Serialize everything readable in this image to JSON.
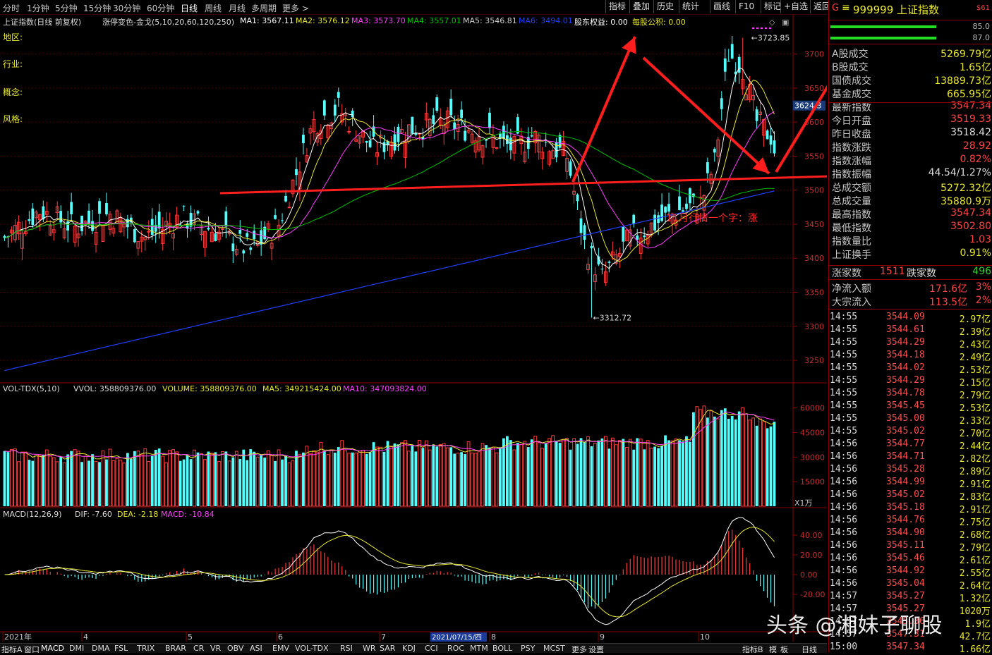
{
  "period_tabs": [
    "分时",
    "1分钟",
    "5分钟",
    "15分钟",
    "30分钟",
    "60分钟",
    "日线",
    "周线",
    "月线",
    "多周期",
    "更多 >"
  ],
  "toolbar_right": [
    "指标",
    "叠加",
    "历史",
    "统计",
    "画线",
    "F10",
    "标记",
    "+自选",
    "返回"
  ],
  "main_info": {
    "name": "上证指数(日线 前复权)",
    "indicator": "涨停变色-金戈(5,10,20,60,120,250)",
    "ma1": "MA1: 3567.11",
    "ma2": "MA2: 3576.12",
    "ma3": "MA3: 3573.70",
    "ma4": "MA4: 3557.01",
    "ma5": "MA5: 3546.81",
    "ma6": "MA6: 3494.01",
    "equity": "股东权益: 0.00",
    "eps": "每股公积: 0.00"
  },
  "side_labels": [
    "地区:",
    "行业:",
    "概念:",
    "风格:"
  ],
  "price_axis": [
    "3700",
    "3650",
    "3600",
    "3550",
    "3500",
    "3450",
    "3400",
    "3350",
    "3300",
    "3250"
  ],
  "price_tag": "3624.3",
  "high_label": "3723.85",
  "low_label": "3312.72",
  "annotation": "11月行情一个字：涨",
  "vol_info": {
    "name": "VOL-TDX(5,10)",
    "vvol": "VVOL: 358809376.00",
    "volume": "VOLUME: 358809376.00",
    "ma5": "MA5: 349215424.00",
    "ma10": "MA10: 347093824.00"
  },
  "vol_axis": [
    "60000",
    "45000",
    "30000",
    "15000"
  ],
  "vol_unit": "X1万",
  "macd_info": {
    "name": "MACD(12,26,9)",
    "dif": "DIF: -7.60",
    "dea": "DEA: -2.18",
    "macd": "MACD: -10.84"
  },
  "macd_axis": [
    "40.00",
    "20.00",
    "0.00",
    "-20.00"
  ],
  "date_axis": [
    "2021年",
    "4",
    "5",
    "6",
    "7",
    "8",
    "9",
    "10"
  ],
  "cursor_date": "2021/07/15/四",
  "right_panel": {
    "header": "999999 上证指数",
    "header_code": "G",
    "header_badge": "$61",
    "bar1_val": "85.0",
    "bar2_val": "87.0",
    "rows": [
      {
        "k": "A股成交",
        "v": "5269.79亿",
        "c": "yellow"
      },
      {
        "k": "B股成交",
        "v": "1.65亿",
        "c": "yellow"
      },
      {
        "k": "国债成交",
        "v": "13889.73亿",
        "c": "yellow"
      },
      {
        "k": "基金成交",
        "v": "665.95亿",
        "c": "yellow"
      },
      {
        "k": "最新指数",
        "v": "3547.34",
        "c": "red"
      },
      {
        "k": "今日开盘",
        "v": "3519.33",
        "c": "red"
      },
      {
        "k": "昨日收盘",
        "v": "3518.42",
        "c": "white"
      },
      {
        "k": "指数涨跌",
        "v": "28.92",
        "c": "red"
      },
      {
        "k": "指数涨幅",
        "v": "0.82%",
        "c": "red"
      },
      {
        "k": "指数振幅",
        "v": "44.54/1.27%",
        "c": "white"
      },
      {
        "k": "总成交额",
        "v": "5272.32亿",
        "c": "yellow"
      },
      {
        "k": "总成交量",
        "v": "35880.9万",
        "c": "yellow"
      },
      {
        "k": "最高指数",
        "v": "3547.34",
        "c": "red"
      },
      {
        "k": "最低指数",
        "v": "3502.80",
        "c": "red"
      },
      {
        "k": "指数量比",
        "v": "1.03",
        "c": "red"
      },
      {
        "k": "上证换手",
        "v": "0.91%",
        "c": "yellow"
      }
    ],
    "updown": {
      "up_label": "涨家数",
      "up": "1511",
      "down_label": "跌家数",
      "down": "496"
    },
    "flows": [
      {
        "k": "净流入额",
        "v": "171.6亿",
        "p": "3%"
      },
      {
        "k": "大宗流入",
        "v": "113.5亿",
        "p": "2%"
      }
    ],
    "ticks": [
      [
        "14:55",
        "3544.09",
        "2.97亿"
      ],
      [
        "14:55",
        "3544.61",
        "2.39亿"
      ],
      [
        "14:55",
        "3544.29",
        "2.43亿"
      ],
      [
        "14:55",
        "3544.18",
        "2.49亿"
      ],
      [
        "14:55",
        "3544.02",
        "2.53亿"
      ],
      [
        "14:55",
        "3544.29",
        "2.15亿"
      ],
      [
        "14:55",
        "3544.78",
        "2.79亿"
      ],
      [
        "14:55",
        "3545.45",
        "2.53亿"
      ],
      [
        "14:55",
        "3545.00",
        "2.33亿"
      ],
      [
        "14:55",
        "3545.02",
        "2.70亿"
      ],
      [
        "14:56",
        "3544.77",
        "2.44亿"
      ],
      [
        "14:56",
        "3544.71",
        "2.82亿"
      ],
      [
        "14:56",
        "3545.28",
        "2.89亿"
      ],
      [
        "14:56",
        "3544.99",
        "2.91亿"
      ],
      [
        "14:56",
        "3545.02",
        "2.83亿"
      ],
      [
        "14:56",
        "3545.18",
        "2.91亿"
      ],
      [
        "14:56",
        "3544.76",
        "2.75亿"
      ],
      [
        "14:56",
        "3544.90",
        "2.68亿"
      ],
      [
        "14:56",
        "3545.11",
        "2.79亿"
      ],
      [
        "14:56",
        "3545.46",
        "2.61亿"
      ],
      [
        "14:56",
        "3544.92",
        "2.55亿"
      ],
      [
        "14:56",
        "3545.04",
        "2.64亿"
      ],
      [
        "14:57",
        "3545.27",
        "1.32亿"
      ],
      [
        "14:57",
        "3545.27",
        "1020万"
      ],
      [
        "14:57",
        "3545.36",
        "1.9亿"
      ],
      [
        "14:57",
        "3547.31",
        "42.7亿"
      ],
      [
        "15:00",
        "3547.34",
        "1.66亿"
      ]
    ]
  },
  "bottom_tabs": [
    "指标A",
    "窗口",
    "MACD",
    "DMI",
    "DMA",
    "FSL",
    "TRIX",
    "BRAR",
    "CR",
    "VR",
    "OBV",
    "ASI",
    "EMV",
    "VOL-TDX",
    "RSI",
    "WR",
    "SAR",
    "KDJ",
    "CCI",
    "ROC",
    "MTM",
    "BOLL",
    "PSY",
    "MCST",
    "更多",
    "设置"
  ],
  "bottom_right": [
    "指标B",
    "模",
    "板",
    "日线"
  ],
  "watermark": "头条 @湘妹子聊股",
  "colors": {
    "up": "#ff3b3b",
    "down": "#54ffff",
    "ma5": "#ffffff",
    "ma10": "#e8e830",
    "ma20": "#ff40ff",
    "ma60": "#00c000",
    "ma250": "#2040ff",
    "arrow": "#ff1e1e",
    "grid": "#8a0000"
  }
}
